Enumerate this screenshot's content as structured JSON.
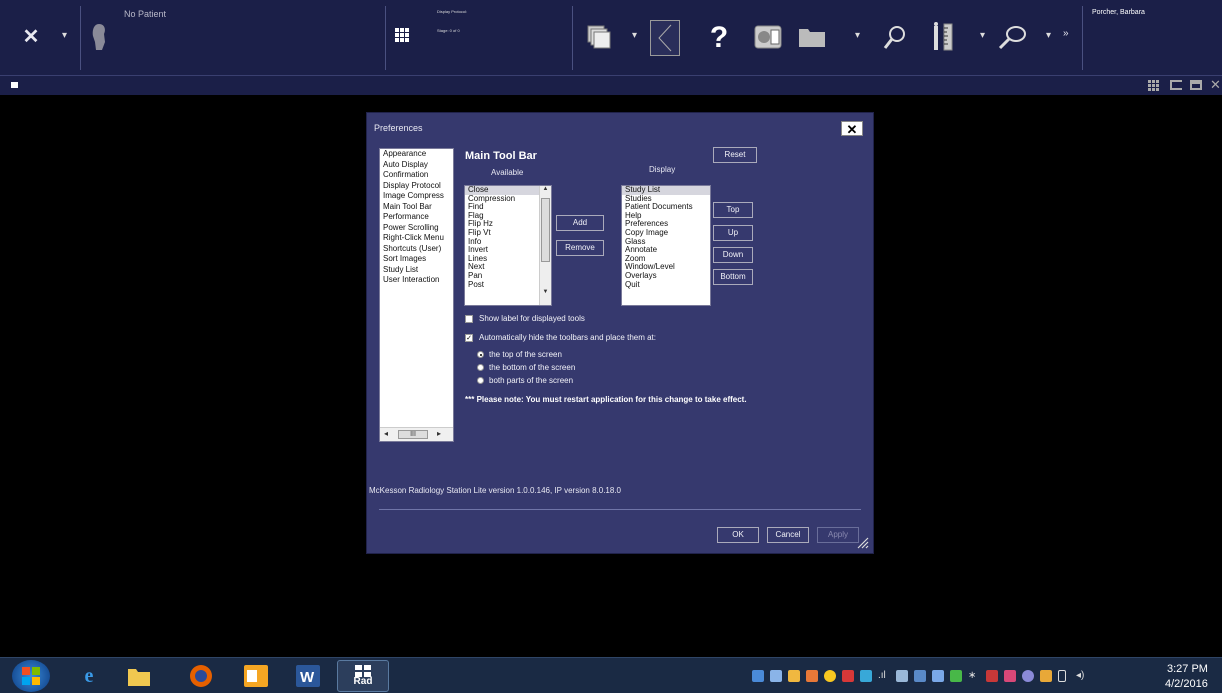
{
  "toolbar": {
    "patient": "No Patient",
    "protocol_label": "Display Protocol:",
    "stage": "Stage: 0 of 0",
    "user": "Porcher, Barbara",
    "more": "»"
  },
  "dialog": {
    "title": "Preferences",
    "close": "✕",
    "categories": [
      "Appearance",
      "Auto Display",
      "Confirmation",
      "Display Protocol",
      "Image Compress",
      "Main Tool Bar",
      "Performance",
      "Power Scrolling",
      "Right-Click Menu",
      "Shortcuts (User)",
      "Sort Images",
      "Study List",
      "User Interaction"
    ],
    "section_title": "Main Tool Bar",
    "available_header": "Available",
    "display_header": "Display",
    "available": [
      "Close",
      "Compression",
      "Find",
      "Flag",
      "Flip Hz",
      "Flip Vt",
      "Info",
      "Invert",
      "Lines",
      "Next",
      "Pan",
      "Post"
    ],
    "display": [
      "Study List",
      "Studies",
      "Patient Documents",
      "Help",
      "Preferences",
      "Copy Image",
      "Glass",
      "Annotate",
      "Zoom",
      "Window/Level",
      "Overlays",
      "Quit"
    ],
    "buttons": {
      "reset": "Reset",
      "add": "Add",
      "remove": "Remove",
      "top": "Top",
      "up": "Up",
      "down": "Down",
      "bottom": "Bottom",
      "ok": "OK",
      "cancel": "Cancel",
      "apply": "Apply"
    },
    "show_label": "Show label for displayed tools",
    "auto_hide": "Automatically hide the toolbars and place them at:",
    "radios": [
      "the top of the screen",
      "the bottom  of the screen",
      "both parts of the screen"
    ],
    "note": "*** Please note: You must restart application for this change to take effect.",
    "version": "McKesson Radiology Station Lite version 1.0.0.146,  IP version 8.0.18.0",
    "scroll_thumb": "III"
  },
  "taskbar": {
    "time": "3:27 PM",
    "date": "4/2/2016",
    "rad_label": "Rad"
  }
}
